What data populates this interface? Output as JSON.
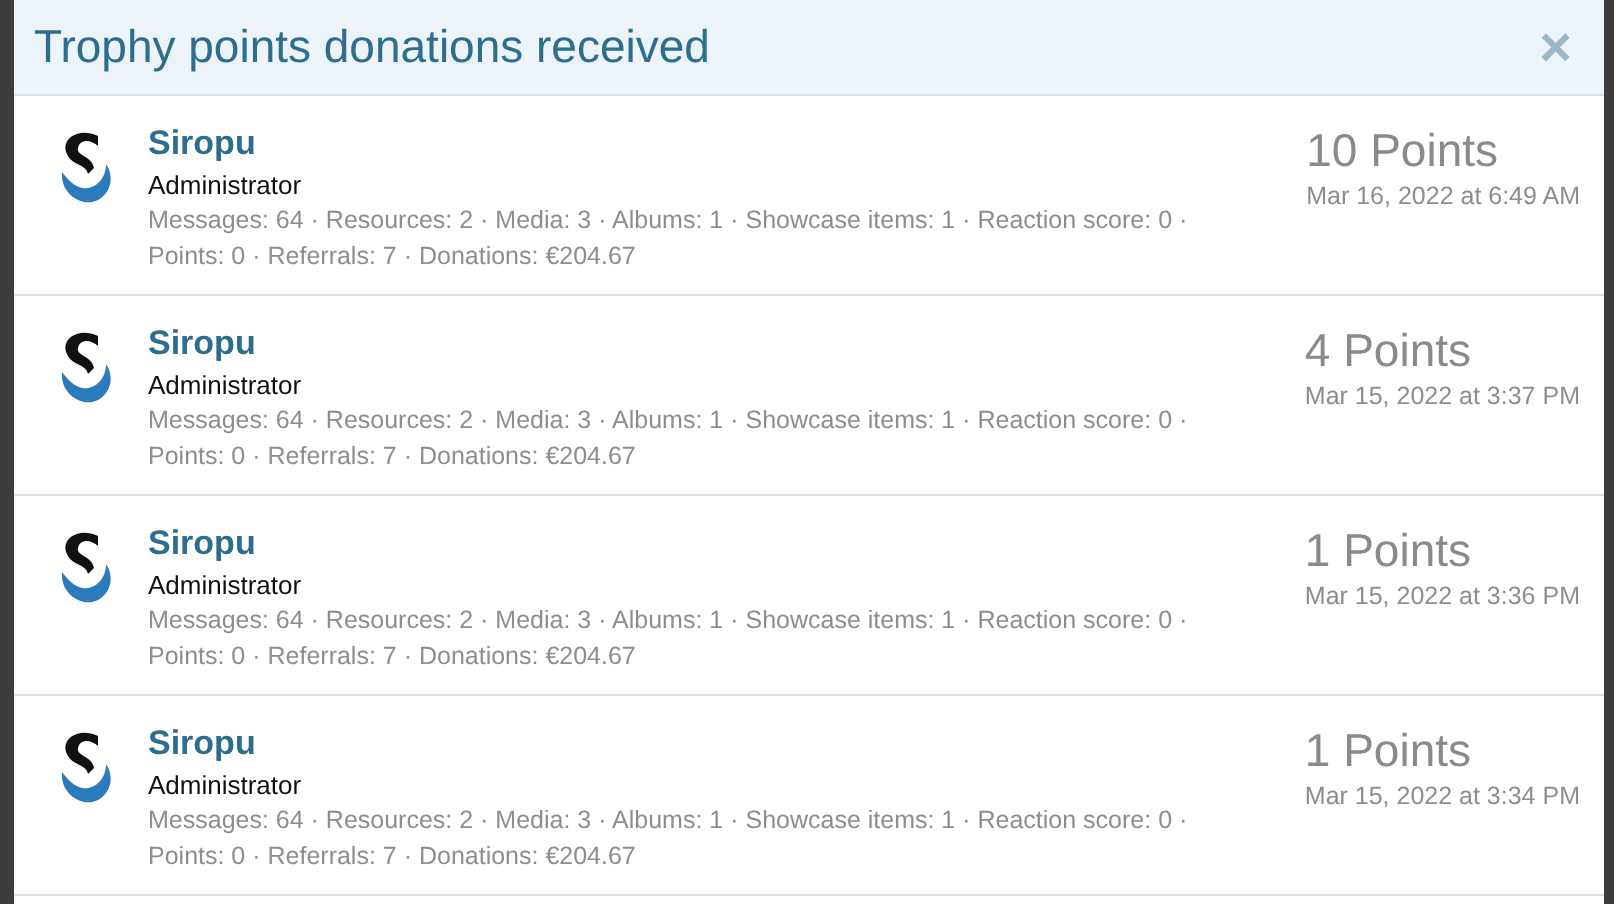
{
  "dialog": {
    "title": "Trophy points donations received",
    "close": "×"
  },
  "donations": [
    {
      "name": "Siropu",
      "role": "Administrator",
      "stats": "Messages: 64 · Resources: 2 · Media: 3 · Albums: 1 · Showcase items: 1 · Reaction score: 0 · Points: 0 · Referrals: 7 · Donations: €204.67",
      "points": "10 Points",
      "date": "Mar 16, 2022 at 6:49 AM"
    },
    {
      "name": "Siropu",
      "role": "Administrator",
      "stats": "Messages: 64 · Resources: 2 · Media: 3 · Albums: 1 · Showcase items: 1 · Reaction score: 0 · Points: 0 · Referrals: 7 · Donations: €204.67",
      "points": "4 Points",
      "date": "Mar 15, 2022 at 3:37 PM"
    },
    {
      "name": "Siropu",
      "role": "Administrator",
      "stats": "Messages: 64 · Resources: 2 · Media: 3 · Albums: 1 · Showcase items: 1 · Reaction score: 0 · Points: 0 · Referrals: 7 · Donations: €204.67",
      "points": "1 Points",
      "date": "Mar 15, 2022 at 3:36 PM"
    },
    {
      "name": "Siropu",
      "role": "Administrator",
      "stats": "Messages: 64 · Resources: 2 · Media: 3 · Albums: 1 · Showcase items: 1 · Reaction score: 0 · Points: 0 · Referrals: 7 · Donations: €204.67",
      "points": "1 Points",
      "date": "Mar 15, 2022 at 3:34 PM"
    }
  ]
}
